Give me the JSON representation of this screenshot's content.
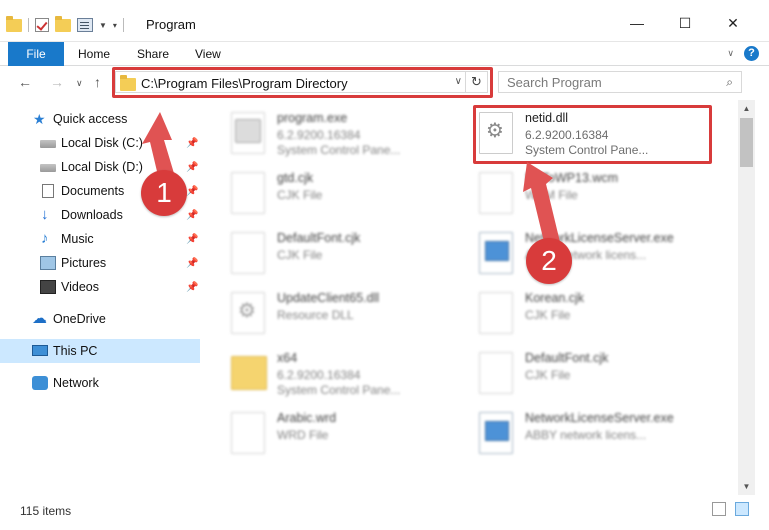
{
  "window": {
    "title": "Program",
    "minimize": "—",
    "maximize": "☐",
    "close": "✕"
  },
  "ribbon": {
    "tabs": [
      "File",
      "Home",
      "Share",
      "View"
    ],
    "help": "?"
  },
  "nav": {
    "address": "C:\\Program Files\\Program Directory",
    "search_placeholder": "Search Program"
  },
  "sidebar": {
    "items": [
      {
        "label": "Quick access",
        "icon": "star-icon",
        "pinned": false
      },
      {
        "label": "Local Disk (C:)",
        "icon": "disk-icon",
        "pinned": true
      },
      {
        "label": "Local Disk (D:)",
        "icon": "disk-icon",
        "pinned": true
      },
      {
        "label": "Documents",
        "icon": "documents-icon",
        "pinned": true
      },
      {
        "label": "Downloads",
        "icon": "download-icon",
        "pinned": true
      },
      {
        "label": "Music",
        "icon": "music-icon",
        "pinned": true
      },
      {
        "label": "Pictures",
        "icon": "pictures-icon",
        "pinned": true
      },
      {
        "label": "Videos",
        "icon": "videos-icon",
        "pinned": true
      },
      {
        "label": "OneDrive",
        "icon": "onedrive-icon",
        "pinned": false
      },
      {
        "label": "This PC",
        "icon": "pc-icon",
        "pinned": false,
        "selected": true
      },
      {
        "label": "Network",
        "icon": "network-icon",
        "pinned": false
      }
    ]
  },
  "files": [
    {
      "name": "program.exe",
      "line1": "6.2.9200.16384",
      "line2": "System Control Pane...",
      "icon": "exe-icon"
    },
    {
      "name": "netid.dll",
      "line1": "6.2.9200.16384",
      "line2": "System Control Pane...",
      "icon": "dll-gear-icon",
      "highlighted": true
    },
    {
      "name": "gtd.cjk",
      "line1": "CJK File",
      "line2": "",
      "icon": "file-icon"
    },
    {
      "name": "MxToWP13.wcm",
      "line1": "WCM File",
      "line2": "",
      "icon": "file-icon"
    },
    {
      "name": "DefaultFont.cjk",
      "line1": "CJK File",
      "line2": "",
      "icon": "file-icon"
    },
    {
      "name": "NetworkLicenseServer.exe",
      "line1": "ABBY network licens...",
      "line2": "",
      "icon": "network-exe-icon"
    },
    {
      "name": "UpdateClient65.dll",
      "line1": "Resource DLL",
      "line2": "",
      "icon": "dll-gear-icon"
    },
    {
      "name": "Korean.cjk",
      "line1": "CJK File",
      "line2": "",
      "icon": "file-icon"
    },
    {
      "name": "x64",
      "line1": "6.2.9200.16384",
      "line2": "System Control Pane...",
      "icon": "folder-icon"
    },
    {
      "name": "DefaultFont.cjk",
      "line1": "CJK File",
      "line2": "",
      "icon": "file-icon"
    },
    {
      "name": "Arabic.wrd",
      "line1": "WRD File",
      "line2": "",
      "icon": "file-icon"
    },
    {
      "name": "NetworkLicenseServer.exe",
      "line1": "ABBY network licens...",
      "line2": "",
      "icon": "network-exe-icon"
    }
  ],
  "status": {
    "item_count": "115 items"
  },
  "callouts": [
    "1",
    "2"
  ],
  "colors": {
    "accent": "#1979ca",
    "highlight": "#d83b3b",
    "selected": "#cce8ff"
  }
}
